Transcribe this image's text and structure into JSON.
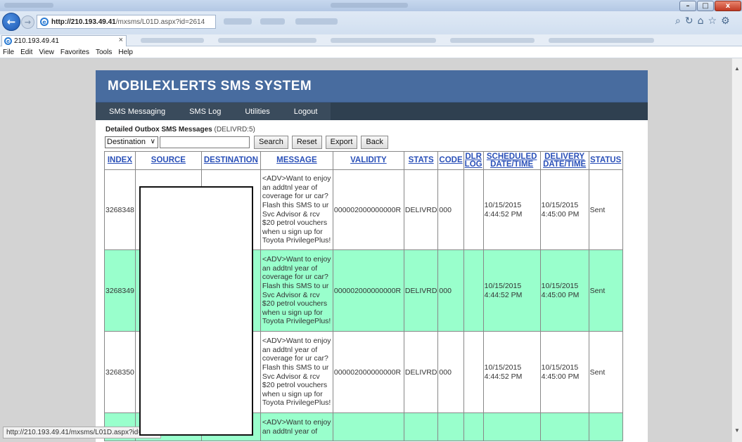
{
  "browser": {
    "url_host": "http://210.193.49.41",
    "url_path": "/mxsms/L01D.aspx?id=2614",
    "tab_title": "210.193.49.41",
    "tab_close": "×",
    "menu": [
      "File",
      "Edit",
      "View",
      "Favorites",
      "Tools",
      "Help"
    ],
    "window_controls": {
      "minimize": "–",
      "maximize": "□",
      "close": "x"
    },
    "status_url": "http://210.193.49.41/mxsms/L01D.aspx?id=2614"
  },
  "app": {
    "brand": "MOBILEXLERTS SMS SYSTEM",
    "nav": [
      "SMS Messaging",
      "SMS Log",
      "Utilities",
      "Logout"
    ]
  },
  "outbox": {
    "title": "Detailed Outbox SMS Messages",
    "filter": "(DELIVRD:5)",
    "search_field_selected": "Destination",
    "search_value": "",
    "buttons": {
      "search": "Search",
      "reset": "Reset",
      "export": "Export",
      "back": "Back"
    }
  },
  "table": {
    "headers": {
      "index": "INDEX",
      "source": "SOURCE",
      "destination": "DESTINATION",
      "message": "MESSAGE",
      "validity": "VALIDITY",
      "stats": "STATS",
      "code": "CODE",
      "dlr1": "DLR",
      "dlr2": "LOG",
      "sched1": "SCHEDULED",
      "sched2": "DATE/TIME",
      "deliv1": "DELIVERY",
      "deliv2": "DATE/TIME",
      "status": "STATUS"
    },
    "rows": [
      {
        "index": "3268348",
        "message_lines": [
          "<ADV>Want to enjoy",
          "an addtnl year of",
          "coverage for ur car?",
          "Flash this SMS to ur",
          "Svc Advisor & rcv",
          "$20 petrol vouchers",
          "when u sign up for",
          "Toyota PrivilegePlus!"
        ],
        "validity": "000002000000000R",
        "stats": "DELIVRD",
        "code": "000",
        "sched_date": "10/15/2015",
        "sched_time": "4:44:52 PM",
        "deliv_date": "10/15/2015",
        "deliv_time": "4:45:00 PM",
        "status": "Sent"
      },
      {
        "index": "3268349",
        "message_lines": [
          "<ADV>Want to enjoy",
          "an addtnl year of",
          "coverage for ur car?",
          "Flash this SMS to ur",
          "Svc Advisor & rcv",
          "$20 petrol vouchers",
          "when u sign up for",
          "Toyota PrivilegePlus!"
        ],
        "validity": "000002000000000R",
        "stats": "DELIVRD",
        "code": "000",
        "sched_date": "10/15/2015",
        "sched_time": "4:44:52 PM",
        "deliv_date": "10/15/2015",
        "deliv_time": "4:45:00 PM",
        "status": "Sent"
      },
      {
        "index": "3268350",
        "message_lines": [
          "<ADV>Want to enjoy",
          "an addtnl year of",
          "coverage for ur car?",
          "Flash this SMS to ur",
          "Svc Advisor & rcv",
          "$20 petrol vouchers",
          "when u sign up for",
          "Toyota PrivilegePlus!"
        ],
        "validity": "000002000000000R",
        "stats": "DELIVRD",
        "code": "000",
        "sched_date": "10/15/2015",
        "sched_time": "4:44:52 PM",
        "deliv_date": "10/15/2015",
        "deliv_time": "4:45:00 PM",
        "status": "Sent"
      },
      {
        "index": "",
        "message_lines": [
          "<ADV>Want to enjoy",
          "an addtnl year of"
        ],
        "validity": "",
        "stats": "",
        "code": "",
        "sched_date": "",
        "sched_time": "",
        "deliv_date": "",
        "deliv_time": "",
        "status": ""
      }
    ]
  }
}
